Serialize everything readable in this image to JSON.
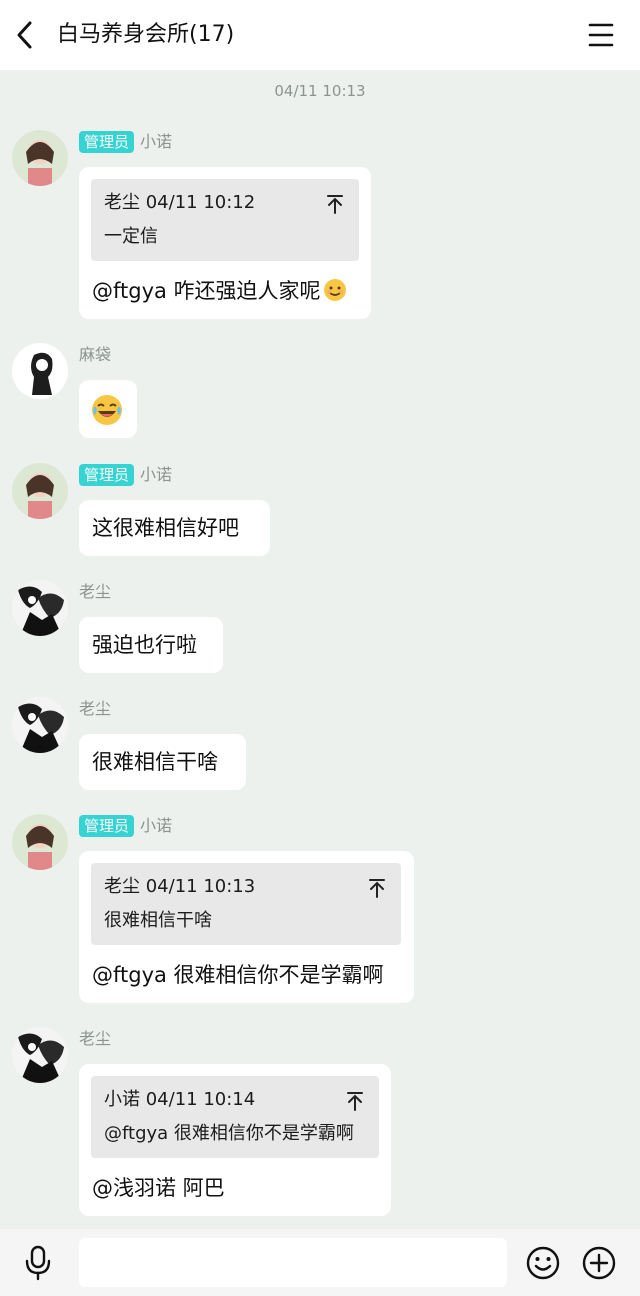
{
  "header": {
    "title": "白马养身会所(17)"
  },
  "time_divider": "04/11 10:13",
  "admin_badge": "管理员",
  "messages": [
    {
      "sender": "小诺",
      "admin": true,
      "avatar": "girl-avatar",
      "quote": {
        "head": "老尘 04/11 10:12",
        "body": "一定信"
      },
      "text": "@ftgya 咋还强迫人家呢"
    },
    {
      "sender": "麻袋",
      "admin": false,
      "avatar": "sketch-avatar",
      "emoji": "laughing-crying-emoji"
    },
    {
      "sender": "小诺",
      "admin": true,
      "avatar": "girl-avatar",
      "text": "这很难相信好吧"
    },
    {
      "sender": "老尘",
      "admin": false,
      "avatar": "manga-avatar",
      "text": "强迫也行啦"
    },
    {
      "sender": "老尘",
      "admin": false,
      "avatar": "manga-avatar",
      "text": "很难相信干啥"
    },
    {
      "sender": "小诺",
      "admin": true,
      "avatar": "girl-avatar",
      "quote": {
        "head": "老尘 04/11 10:13",
        "body": "很难相信干啥"
      },
      "text": "@ftgya 很难相信你不是学霸啊"
    },
    {
      "sender": "老尘",
      "admin": false,
      "avatar": "manga-avatar",
      "quote": {
        "head": "小诺 04/11 10:14",
        "body": "@ftgya 很难相信你不是学霸啊"
      },
      "text": "@浅羽诺 阿巴"
    }
  ],
  "input_bar": {
    "placeholder": ""
  },
  "icons": [
    "back-icon",
    "menu-icon",
    "pin-to-top-icon",
    "smile-emoji",
    "mic-icon",
    "emoji-icon",
    "plus-icon"
  ]
}
